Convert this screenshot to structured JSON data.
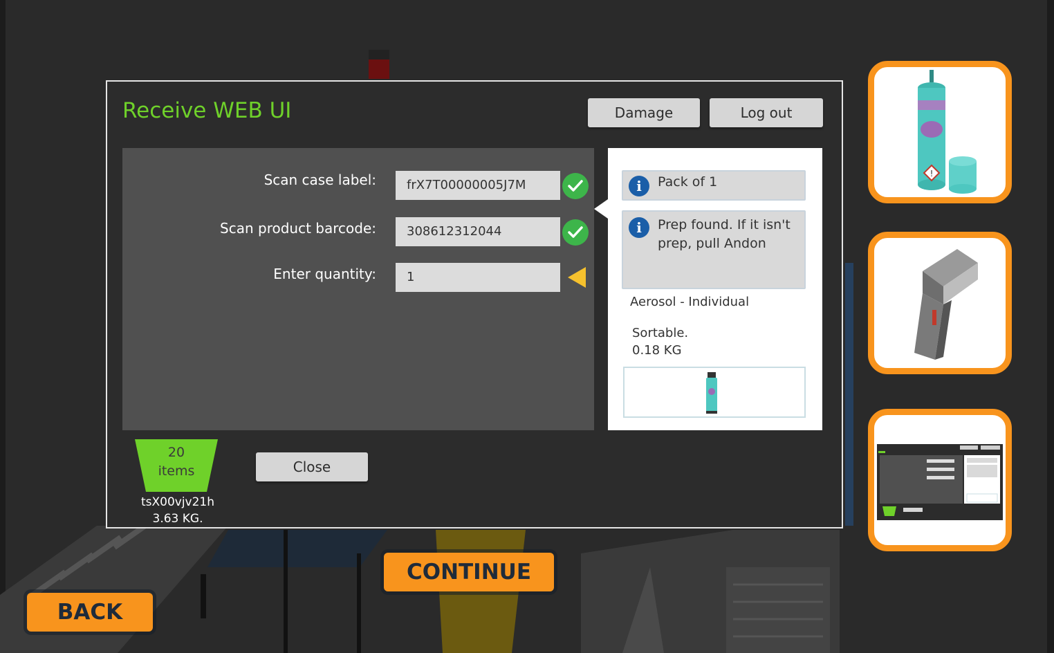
{
  "dialog": {
    "title": "Receive WEB UI",
    "damage_label": "Damage",
    "logout_label": "Log out",
    "close_label": "Close"
  },
  "form": {
    "case_label": "Scan case label:",
    "case_value": "frX7T00000005J7M",
    "barcode_label": "Scan product barcode:",
    "barcode_value": "308612312044",
    "quantity_label": "Enter quantity:",
    "quantity_value": "1"
  },
  "info": {
    "pack": "Pack of 1",
    "prep_message": "Prep found. If it isn't prep, pull Andon",
    "category": "Aerosol - Individual",
    "sortable": "Sortable.",
    "weight": "0.18 KG"
  },
  "tote": {
    "count": "20",
    "unit": "items",
    "id": "tsX00vjv21h",
    "weight": "3.63 KG."
  },
  "nav": {
    "continue_label": "CONTINUE",
    "back_label": "BACK"
  },
  "colors": {
    "accent_green": "#6fd12a",
    "orange": "#f8941d",
    "check_green": "#3db54a",
    "warning_yellow": "#f6c12d",
    "info_blue": "#1a5ea8"
  },
  "icons": [
    "check-icon",
    "info-icon",
    "arrow-left-icon",
    "aerosol-can-icon",
    "barcode-scanner-icon"
  ]
}
